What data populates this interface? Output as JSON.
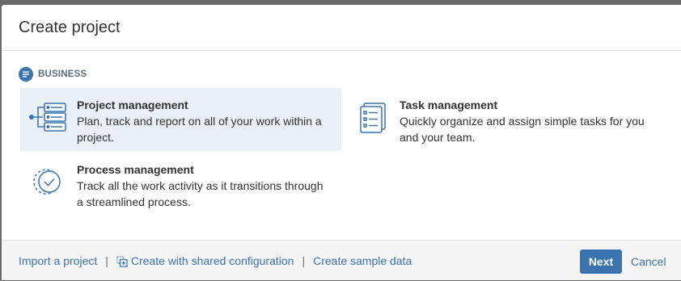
{
  "dialog": {
    "title": "Create project"
  },
  "section": {
    "label": "BUSINESS",
    "icon": "list-icon"
  },
  "options": [
    {
      "title": "Project management",
      "description": "Plan, track and report on all of your work within a project.",
      "icon": "project-management-icon",
      "selected": true
    },
    {
      "title": "Task management",
      "description": "Quickly organize and assign simple tasks for you and your team.",
      "icon": "task-management-icon",
      "selected": false
    },
    {
      "title": "Process management",
      "description": "Track all the work activity as it transitions through a streamlined process.",
      "icon": "process-management-icon",
      "selected": false
    }
  ],
  "footer": {
    "import_label": "Import a project",
    "shared_config_label": "Create with shared configuration",
    "sample_data_label": "Create sample data",
    "separator": "|",
    "next_label": "Next",
    "cancel_label": "Cancel"
  },
  "colors": {
    "accent": "#3b73af",
    "selected_bg": "#e9f0f8"
  }
}
